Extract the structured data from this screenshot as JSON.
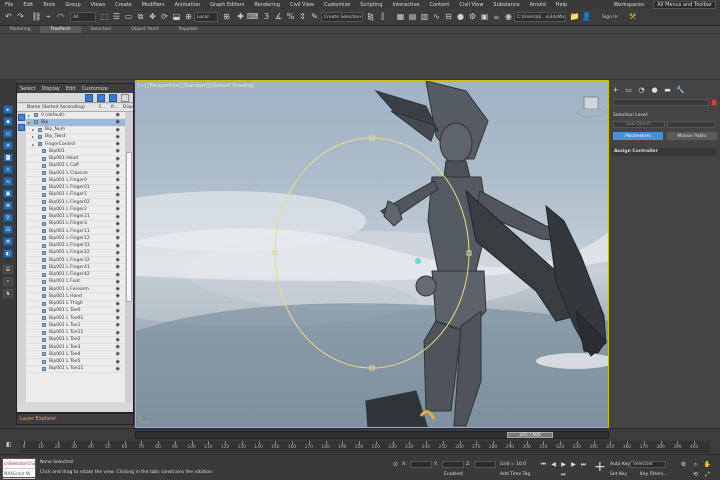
{
  "menu": [
    "File",
    "Edit",
    "Tools",
    "Group",
    "Views",
    "Create",
    "Modifiers",
    "Animation",
    "Graph Editors",
    "Rendering",
    "Civil View",
    "Customize",
    "Scripting",
    "Interactive",
    "Content",
    "Civil View",
    "Substance",
    "Arnold",
    "Help"
  ],
  "workspace": {
    "label": "Workspaces:",
    "value": "All Menus and Toolbar"
  },
  "toolbar": {
    "filter_dropdown": "All",
    "view_dropdown": "Local",
    "selection_set": "Create Selection Se",
    "path": "C:\\Users\\pl...s\\3dsMax",
    "sign_in": "Sign In"
  },
  "ribbon_tabs": [
    "Modeling",
    "Freeform",
    "Selection",
    "Object Paint",
    "Populate"
  ],
  "ribbon_active": 1,
  "scene_explorer": {
    "menu": [
      "Select",
      "Display",
      "Edit",
      "Customize"
    ],
    "column_name": "Name (Sorted Ascending)",
    "column_f": "F...",
    "column_r": "R...",
    "column_disp": "Disp",
    "rows": [
      {
        "name": "0 (default)",
        "sel": false
      },
      {
        "name": "Bip",
        "sel": true
      },
      {
        "name": "Bip_Num",
        "sel": false
      },
      {
        "name": "Bip_Twist",
        "sel": false
      },
      {
        "name": "FingerControl",
        "sel": false
      },
      {
        "name": "Bip001",
        "sel": false
      },
      {
        "name": "Bip001 Head",
        "sel": false
      },
      {
        "name": "Bip001 L Calf",
        "sel": false
      },
      {
        "name": "Bip001 L Clavicle",
        "sel": false
      },
      {
        "name": "Bip001 L Finger0",
        "sel": false
      },
      {
        "name": "Bip001 L Finger01",
        "sel": false
      },
      {
        "name": "Bip001 L Finger1",
        "sel": false
      },
      {
        "name": "Bip001 L Finger02",
        "sel": false
      },
      {
        "name": "Bip001 L Finger2",
        "sel": false
      },
      {
        "name": "Bip001 L Finger21",
        "sel": false
      },
      {
        "name": "Bip001 L Finger3",
        "sel": false
      },
      {
        "name": "Bip001 L Finger11",
        "sel": false
      },
      {
        "name": "Bip001 L Finger12",
        "sel": false
      },
      {
        "name": "Bip001 L Finger31",
        "sel": false
      },
      {
        "name": "Bip001 L Finger22",
        "sel": false
      },
      {
        "name": "Bip001 L Finger32",
        "sel": false
      },
      {
        "name": "Bip001 L Finger41",
        "sel": false
      },
      {
        "name": "Bip001 L Finger42",
        "sel": false
      },
      {
        "name": "Bip001 L Foot",
        "sel": false
      },
      {
        "name": "Bip001 L Forearm",
        "sel": false
      },
      {
        "name": "Bip001 L Hand",
        "sel": false
      },
      {
        "name": "Bip001 L Thigh",
        "sel": false
      },
      {
        "name": "Bip001 L Toe0",
        "sel": false
      },
      {
        "name": "Bip001 L Toe01",
        "sel": false
      },
      {
        "name": "Bip001 L Toe1",
        "sel": false
      },
      {
        "name": "Bip001 L Toe11",
        "sel": false
      },
      {
        "name": "Bip001 L Toe2",
        "sel": false
      },
      {
        "name": "Bip001 L Toe3",
        "sel": false
      },
      {
        "name": "Bip001 L Toe4",
        "sel": false
      },
      {
        "name": "Bip001 L Toe5",
        "sel": false
      },
      {
        "name": "Bip001 L Toe11",
        "sel": false
      }
    ],
    "layer_explorer": "Layer Explorer"
  },
  "viewport": {
    "label": "[+] [Perspective] [Standard] [Default Shading]"
  },
  "command_panel": {
    "tab_icons": [
      "+",
      "▭",
      "◔",
      "●",
      "▬",
      "🔧"
    ],
    "selection_level": "Selection Level:",
    "sub_object": "Sub-Object",
    "parameters": "Parameters",
    "motion_paths": "Motion Paths",
    "rollout": "Assign Controller"
  },
  "timeline": {
    "frame": "205 / 400",
    "ticks": [
      0,
      10,
      20,
      30,
      40,
      50,
      60,
      70,
      80,
      90,
      100,
      110,
      120,
      130,
      140,
      150,
      160,
      170,
      180,
      190,
      200,
      210,
      220,
      230,
      240,
      250,
      260,
      270,
      280,
      290,
      300,
      310,
      320,
      330,
      340,
      350,
      360,
      370,
      380,
      390,
      400
    ]
  },
  "status": {
    "maxscript_line1": "onSelectionChanged",
    "maxscript_line2": "MAXScript Mi",
    "none_selected": "None Selected",
    "hint": "Click and drag to rotate the view.  Clicking in the tabs constrains the rotation.",
    "x_label": "X:",
    "y_label": "Y:",
    "z_label": "Z:",
    "grid": "Grid = 10.0",
    "enabled": "Enabled:",
    "add_time_tag": "Add Time Tag",
    "auto_key": "Auto Key",
    "set_key": "Set Key",
    "selected": "Selected",
    "key_filters": "Key Filters..."
  },
  "colors": {
    "accent": "#2a6ab0",
    "viewport_border": "#d4b800",
    "layer_text": "#e0b040",
    "gizmo": "#e8d890"
  }
}
